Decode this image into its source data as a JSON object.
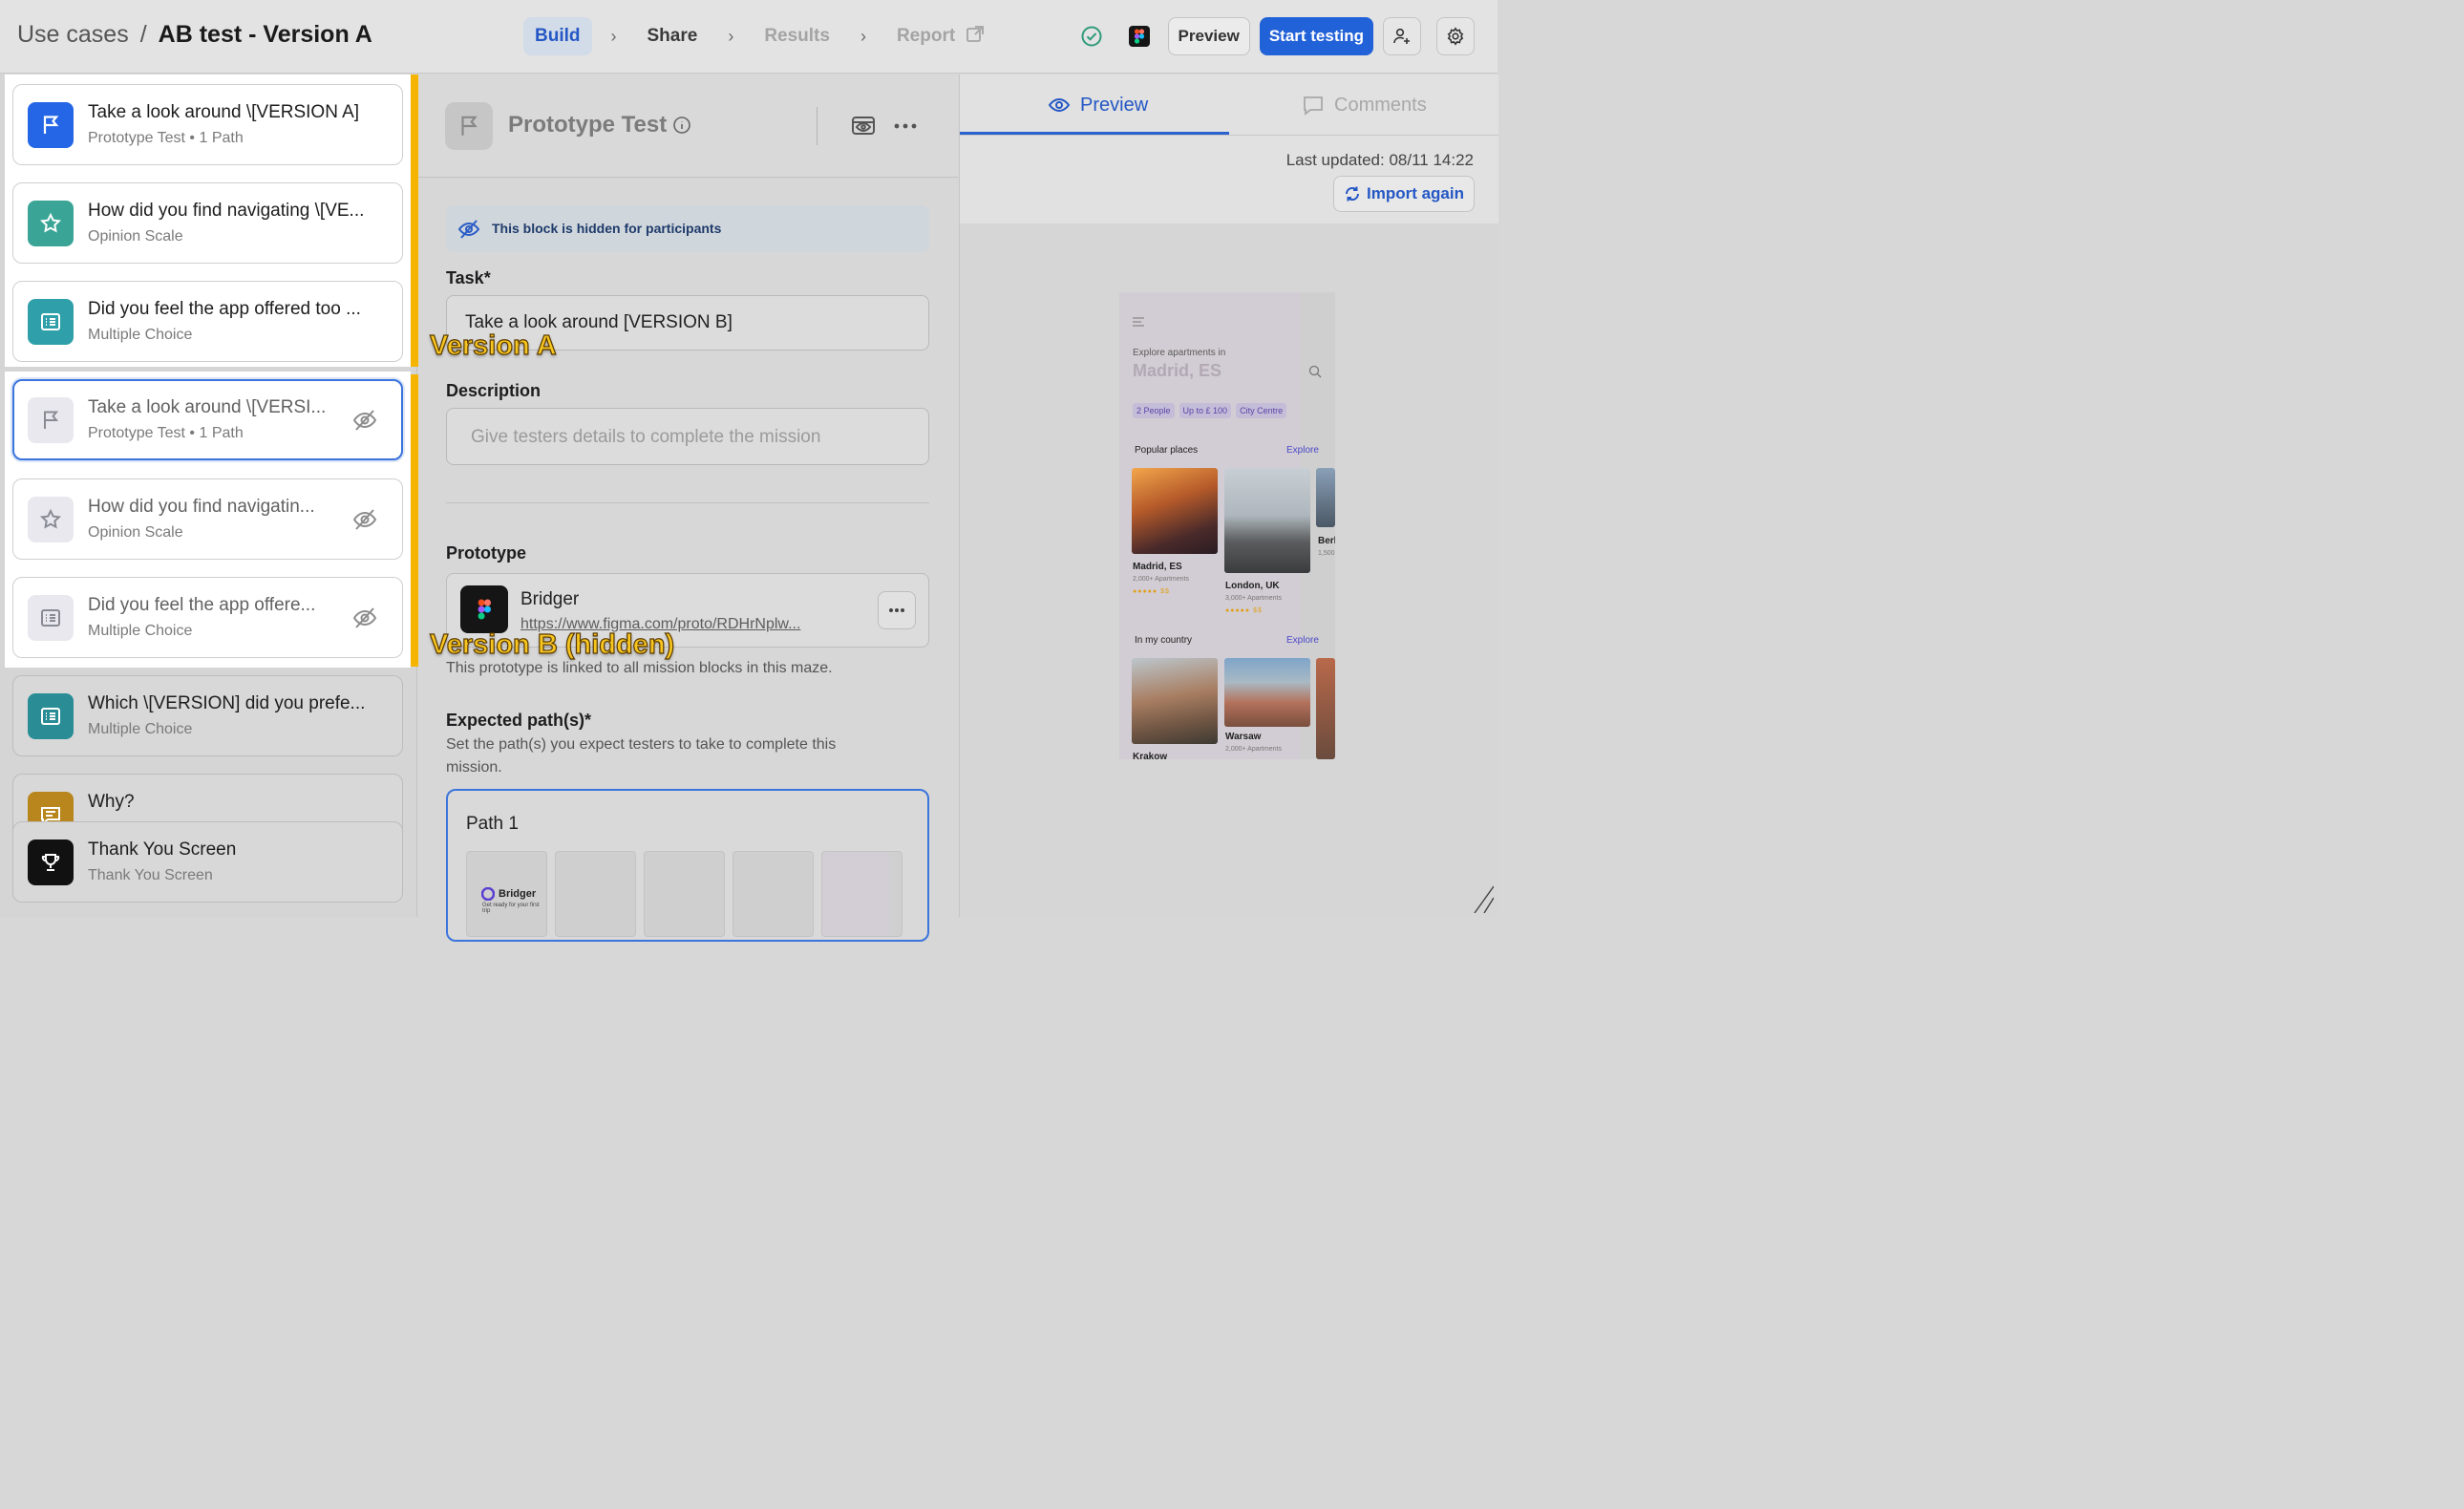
{
  "header": {
    "breadcrumb_parent": "Use cases",
    "breadcrumb_sep": "/",
    "breadcrumb_current": "AB test - Version A",
    "steps": {
      "build": "Build",
      "share": "Share",
      "results": "Results",
      "report": "Report"
    },
    "preview_label": "Preview",
    "start_label": "Start testing"
  },
  "blocks": [
    {
      "title": "Take a look around \\[VERSION A]",
      "subtitle": "Prototype Test • 1 Path",
      "icon": "flag-icon",
      "color": "#2466e6"
    },
    {
      "title": "How did you find navigating \\[VE...",
      "subtitle": "Opinion Scale",
      "icon": "star-icon",
      "color": "#3aa596"
    },
    {
      "title": "Did you feel the app offered too ...",
      "subtitle": "Multiple Choice",
      "icon": "list-icon",
      "color": "#2f9fa9"
    },
    {
      "title": "Take a look around \\[VERSI...",
      "subtitle": "Prototype Test • 1 Path",
      "icon": "flag-icon",
      "hidden": true
    },
    {
      "title": "How did you find navigatin...",
      "subtitle": "Opinion Scale",
      "icon": "star-icon",
      "hidden": true
    },
    {
      "title": "Did you feel the app offere...",
      "subtitle": "Multiple Choice",
      "icon": "list-icon",
      "hidden": true
    },
    {
      "title": "Which \\[VERSION] did you prefe...",
      "subtitle": "Multiple Choice",
      "icon": "list-icon",
      "color": "#2a8d96"
    },
    {
      "title": "Why?",
      "subtitle": "",
      "icon": "comment-icon",
      "color": "#b8861d"
    },
    {
      "title": "Thank You Screen",
      "subtitle": "Thank You Screen",
      "icon": "trophy-icon",
      "color": "#111111"
    }
  ],
  "annotations": {
    "version_a": "Version A",
    "version_b": "Version B (hidden)"
  },
  "editor": {
    "block_type": "Prototype Test",
    "hidden_notice": "This block is hidden for participants",
    "task_label": "Task*",
    "task_value": "Take a look around [VERSION B]",
    "description_label": "Description",
    "description_placeholder": "Give testers details to complete the mission",
    "prototype_label": "Prototype",
    "prototype_name": "Bridger",
    "prototype_url": "https://www.figma.com/proto/RDHrNplw...",
    "prototype_note": "This prototype is linked to all mission blocks in this maze.",
    "expected_label": "Expected path(s)*",
    "expected_help_1": "Set the path(s) you expect testers to take to complete this",
    "expected_help_2": "mission.",
    "path_label": "Path 1",
    "thumb_brand": "Bridger",
    "thumb_tagline": "Get ready for your first trip"
  },
  "preview_panel": {
    "tab_preview": "Preview",
    "tab_comments": "Comments",
    "last_updated": "Last updated: 08/11 14:22",
    "import_label": "Import again",
    "phone": {
      "explore_label": "Explore apartments in",
      "location": "Madrid, ES",
      "chips": [
        "2 People",
        "Up to £ 100",
        "City Centre"
      ],
      "popular_label": "Popular places",
      "explore_link": "Explore",
      "places": [
        {
          "name": "Madrid, ES",
          "sub": "2,000+ Apartments"
        },
        {
          "name": "London, UK",
          "sub": "3,000+ Apartments"
        },
        {
          "name": "Berl",
          "sub": "1,500"
        }
      ],
      "country_label": "In my country",
      "country_places": [
        {
          "name": "Krakow",
          "sub": ""
        },
        {
          "name": "Warsaw",
          "sub": "2,000+ Apartments"
        }
      ],
      "stars": "●●●●● $$"
    }
  }
}
